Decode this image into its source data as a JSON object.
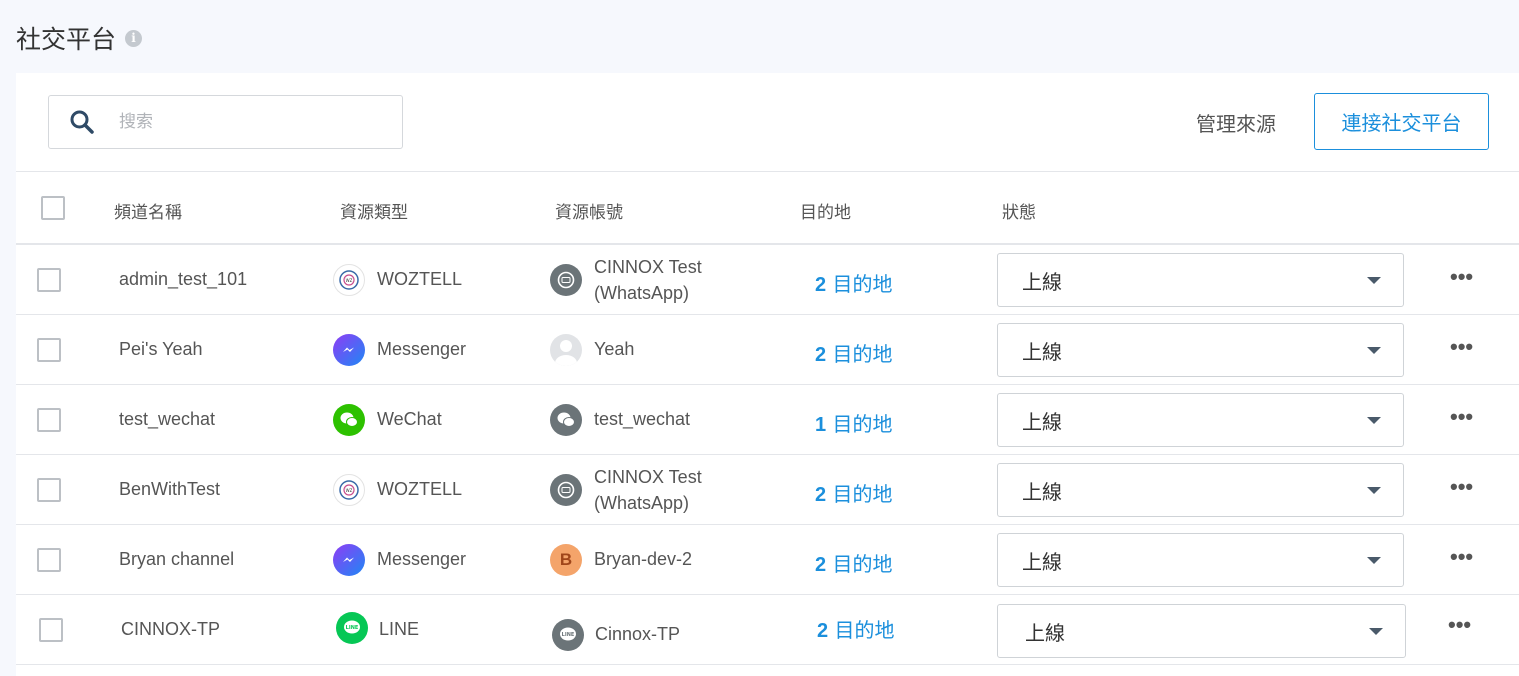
{
  "page": {
    "title": "社交平台"
  },
  "toolbar": {
    "search_placeholder": "搜索",
    "manage_label": "管理來源",
    "connect_label": "連接社交平台"
  },
  "table": {
    "headers": {
      "channel_name": "頻道名稱",
      "source_type": "資源類型",
      "source_account": "資源帳號",
      "destination": "目的地",
      "status": "狀態"
    },
    "rows": [
      {
        "name": "admin_test_101",
        "type": "WOZTELL",
        "type_icon": "woztell-icon",
        "account_line1": "CINNOX Test",
        "account_line2": "(WhatsApp)",
        "account_icon": "whatsapp-avatar-icon",
        "dest_count": "2",
        "dest_label": "目的地",
        "status": "上線"
      },
      {
        "name": "Pei's Yeah",
        "type": "Messenger",
        "type_icon": "messenger-icon",
        "account_line1": "Yeah",
        "account_line2": "",
        "account_icon": "user-avatar-icon",
        "dest_count": "2",
        "dest_label": "目的地",
        "status": "上線"
      },
      {
        "name": "test_wechat",
        "type": "WeChat",
        "type_icon": "wechat-icon",
        "account_line1": "test_wechat",
        "account_line2": "",
        "account_icon": "wechat-avatar-icon",
        "dest_count": "1",
        "dest_label": "目的地",
        "status": "上線"
      },
      {
        "name": "BenWithTest",
        "type": "WOZTELL",
        "type_icon": "woztell-icon",
        "account_line1": "CINNOX Test",
        "account_line2": "(WhatsApp)",
        "account_icon": "whatsapp-avatar-icon",
        "dest_count": "2",
        "dest_label": "目的地",
        "status": "上線"
      },
      {
        "name": "Bryan channel",
        "type": "Messenger",
        "type_icon": "messenger-icon",
        "account_line1": "Bryan-dev-2",
        "account_line2": "",
        "account_icon": "letter-avatar-icon",
        "account_initial": "B",
        "dest_count": "2",
        "dest_label": "目的地",
        "status": "上線"
      },
      {
        "name": "CINNOX-TP",
        "type": "LINE",
        "type_icon": "line-icon",
        "account_line1": "Cinnox-TP",
        "account_line2": "",
        "account_icon": "line-avatar-icon",
        "dest_count": "2",
        "dest_label": "目的地",
        "status": "上線"
      }
    ]
  },
  "colors": {
    "accent": "#1b8fdc",
    "messenger_start": "#8f3cf5",
    "messenger_end": "#1e88f5",
    "wechat": "#2dc100",
    "line": "#06c755",
    "avatar_b": "#f4a46a"
  }
}
